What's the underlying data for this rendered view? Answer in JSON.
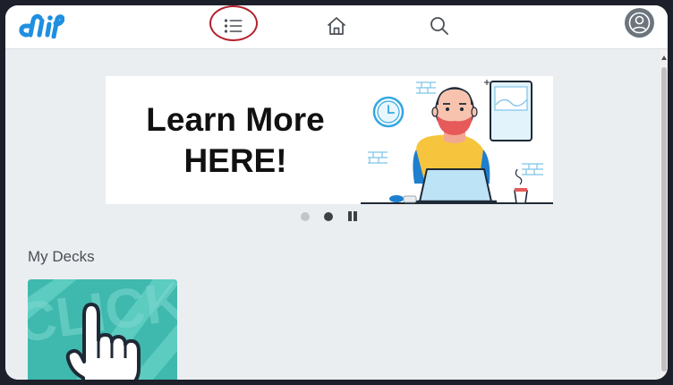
{
  "banner": {
    "line1": "Learn More",
    "line2": "HERE!"
  },
  "decks": {
    "title": "My Decks",
    "cards": [
      {
        "cover_text": "CLICK"
      }
    ]
  },
  "carousel": {
    "slide_count": 2,
    "active_index": 1
  },
  "icons": {
    "logo": "flip-logo",
    "menu": "list-icon",
    "home": "home-icon",
    "search": "search-icon",
    "account": "user-icon",
    "pause": "pause-icon"
  },
  "colors": {
    "brand_blue": "#1f8fe0",
    "highlight_red": "#b3202c",
    "deck_teal": "#3fb8ad",
    "background": "#ebeef1"
  }
}
